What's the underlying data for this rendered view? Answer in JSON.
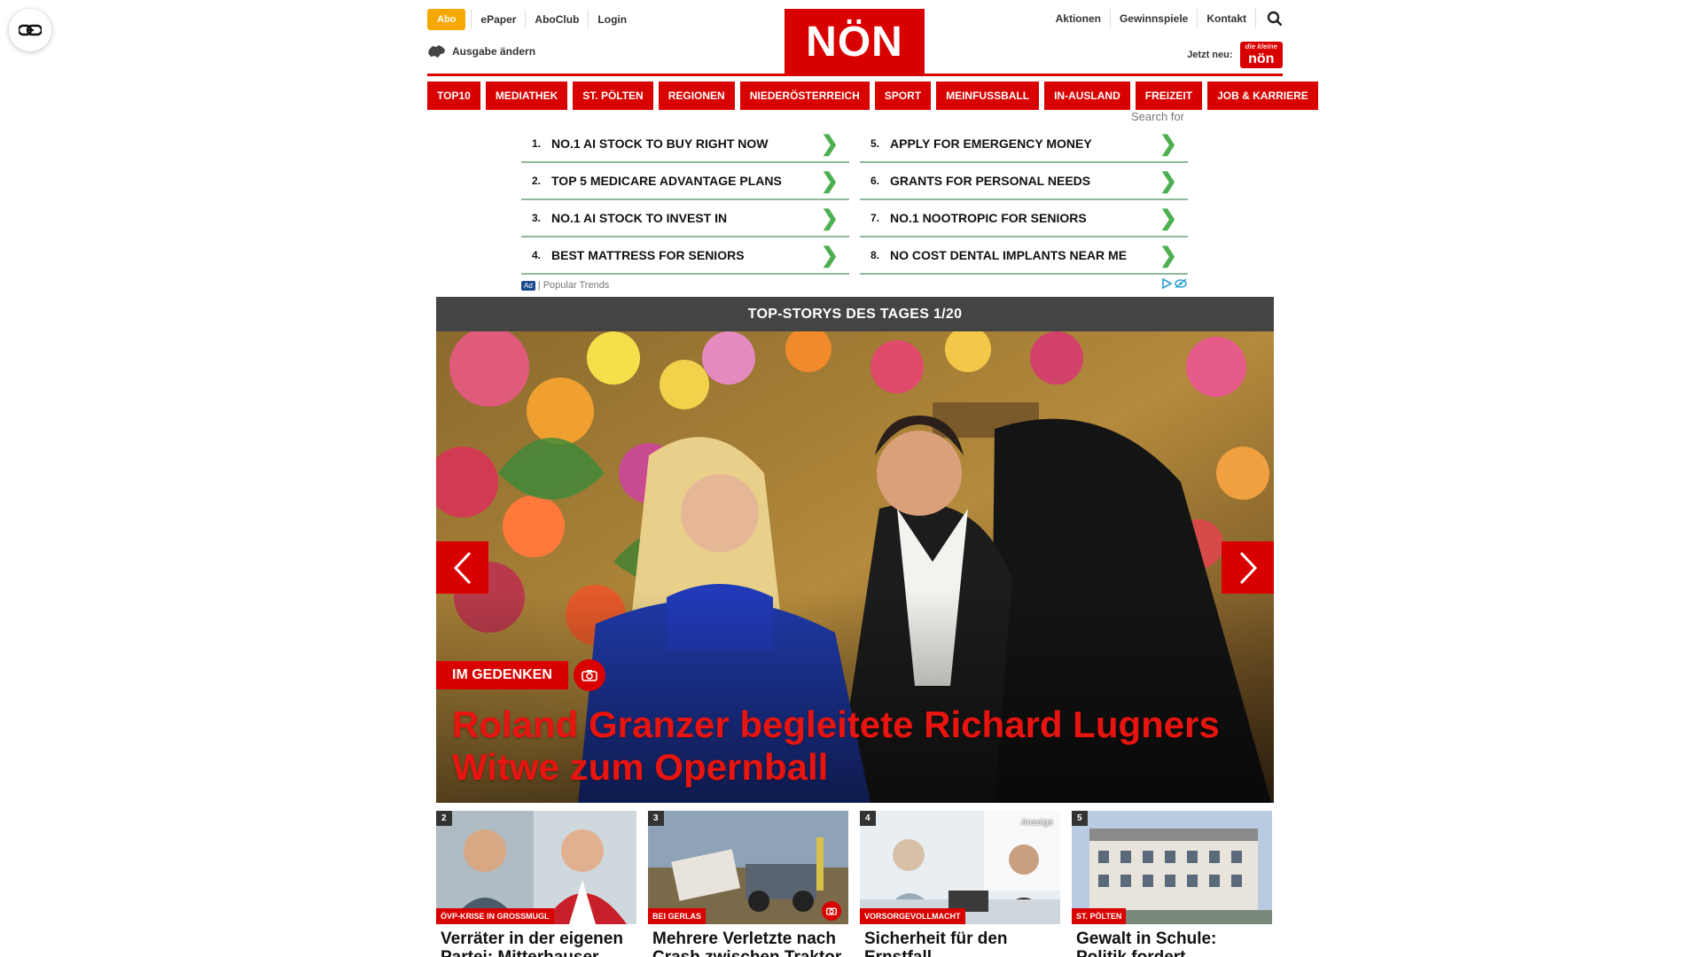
{
  "header": {
    "abo_label": "Abo",
    "top_links_left": [
      "ePaper",
      "AboClub",
      "Login"
    ],
    "edition_label": "Ausgabe ändern",
    "logo_text": "NÖN",
    "top_links_right": [
      "Aktionen",
      "Gewinnspiele",
      "Kontakt"
    ],
    "jetzt_label": "Jetzt neu:",
    "badge_small": "die kleine",
    "badge_text": "nön"
  },
  "nav": [
    "TOP10",
    "MEDIATHEK",
    "ST. PÖLTEN",
    "REGIONEN",
    "NIEDERÖSTERREICH",
    "SPORT",
    "MEINFUSSBALL",
    "IN-AUSLAND",
    "FREIZEIT",
    "JOB & KARRIERE"
  ],
  "ads": {
    "search_for": "Search for",
    "items": [
      {
        "num": "1.",
        "label": "NO.1 AI STOCK TO BUY RIGHT NOW"
      },
      {
        "num": "5.",
        "label": "APPLY FOR EMERGENCY MONEY"
      },
      {
        "num": "2.",
        "label": "TOP 5 MEDICARE ADVANTAGE PLANS"
      },
      {
        "num": "6.",
        "label": "GRANTS FOR PERSONAL NEEDS"
      },
      {
        "num": "3.",
        "label": "NO.1 AI STOCK TO INVEST IN"
      },
      {
        "num": "7.",
        "label": "NO.1 NOOTROPIC FOR SENIORS"
      },
      {
        "num": "4.",
        "label": "BEST MATTRESS FOR SENIORS"
      },
      {
        "num": "8.",
        "label": "NO COST DENTAL IMPLANTS NEAR ME"
      }
    ],
    "ad_tag": "Ad",
    "footer_label": "| Popular Trends"
  },
  "stories": {
    "heading": "TOP-STORYS DES TAGES 1/20",
    "hero": {
      "tag": "IM GEDENKEN",
      "title": "Roland Granzer begleitete Richard Lugners Witwe zum Opernball"
    },
    "teasers": [
      {
        "num": "2",
        "kicker": "ÖVP-KRISE IN GROSSMUGL",
        "title": "Verräter in der eigenen Partei: Mitterhauser"
      },
      {
        "num": "3",
        "kicker": "BEI GERLAS",
        "title": "Mehrere Verletzte nach Crash zwischen Traktor"
      },
      {
        "num": "4",
        "kicker": "VORSORGEVOLLMACHT",
        "title": "Sicherheit für den Ernstfall",
        "ad": "Anzeige"
      },
      {
        "num": "5",
        "kicker": "ST. PÖLTEN",
        "title": "Gewalt in Schule: Politik fordert Konsequenzen"
      }
    ]
  },
  "colors": {
    "brand_red": "#d90000",
    "abo_orange": "#f5a800",
    "headline_red": "#e8140f"
  }
}
